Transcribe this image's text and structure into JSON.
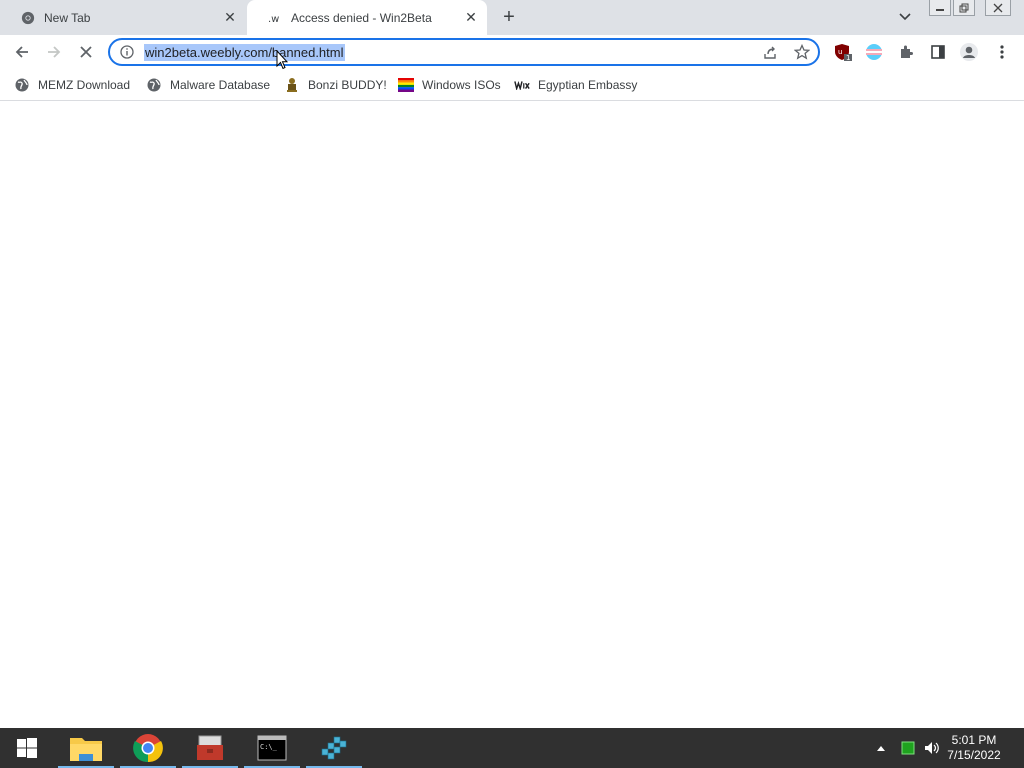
{
  "tabs": [
    {
      "title": "New Tab",
      "active": false
    },
    {
      "title": "Access denied - Win2Beta",
      "active": true
    }
  ],
  "omnibox": {
    "url": "win2beta.weebly.com/banned.html"
  },
  "bookmarks": [
    {
      "label": "MEMZ Download",
      "icon": "globe-icon"
    },
    {
      "label": "Malware Database",
      "icon": "globe-icon"
    },
    {
      "label": "Bonzi BUDDY!",
      "icon": "bonzi-icon"
    },
    {
      "label": "Windows ISOs",
      "icon": "rainbow-flag-icon"
    },
    {
      "label": "Egyptian Embassy",
      "icon": "wix-icon"
    }
  ],
  "extensions": {
    "ublock_badge": "1"
  },
  "taskbar": {
    "time": "5:01 PM",
    "date": "7/15/2022"
  },
  "colors": {
    "accent": "#1a73e8",
    "selection": "#a8c7fa",
    "tabstrip": "#dee1e6",
    "taskbar": "#303030"
  }
}
